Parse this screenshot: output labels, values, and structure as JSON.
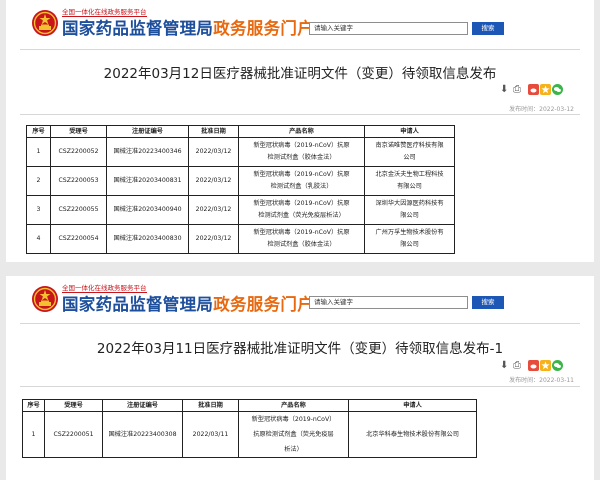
{
  "site": {
    "tagline": "全国一体化在线政务服务平台",
    "name_part1": "国家药品监督管理局",
    "name_part2": "政务服务门户",
    "search_placeholder": "请输入关键字",
    "search_button": "搜索"
  },
  "share_icons": [
    "download-icon",
    "print-icon",
    "weibo-icon",
    "qzone-icon",
    "wechat-icon"
  ],
  "colors": {
    "brand_blue": "#1d4f9c",
    "brand_orange": "#e86a10",
    "search_blue": "#1d57b5",
    "emblem_red": "#c8141b"
  },
  "columns": [
    "序号",
    "受理号",
    "注册证编号",
    "批准日期",
    "产品名称",
    "申请人"
  ],
  "posts": [
    {
      "title": "2022年03月12日医疗器械批准证明文件（变更）待领取信息发布",
      "date": "发布时间：2022-03-12",
      "rows": [
        {
          "no": "1",
          "accept": "CSZ2200052",
          "reg": "国械注准20223400346",
          "date": "2022/03/12",
          "product": [
            "新型冠状病毒（2019-nCoV）抗原",
            "检测试剂盒（胶体金法）"
          ],
          "applicant": [
            "南京诺唯赞医疗科技有限",
            "公司"
          ]
        },
        {
          "no": "2",
          "accept": "CSZ2200053",
          "reg": "国械注准20203400831",
          "date": "2022/03/12",
          "product": [
            "新型冠状病毒（2019-nCoV）抗原",
            "检测试剂盒（乳胶法）"
          ],
          "applicant": [
            "北京金沃夫生物工程科技",
            "有限公司"
          ]
        },
        {
          "no": "3",
          "accept": "CSZ2200055",
          "reg": "国械注准20203400940",
          "date": "2022/03/12",
          "product": [
            "新型冠状病毒（2019-nCoV）抗原",
            "检测试剂盒（荧光免疫层析法）"
          ],
          "applicant": [
            "深圳华大因源医药科技有",
            "限公司"
          ]
        },
        {
          "no": "4",
          "accept": "CSZ2200054",
          "reg": "国械注准20203400830",
          "date": "2022/03/12",
          "product": [
            "新型冠状病毒（2019-nCoV）抗原",
            "检测试剂盒（胶体金法）"
          ],
          "applicant": [
            "广州万孚生物技术股份有",
            "限公司"
          ]
        }
      ]
    },
    {
      "title": "2022年03月11日医疗器械批准证明文件（变更）待领取信息发布-1",
      "date": "发布时间：2022-03-11",
      "rows": [
        {
          "no": "1",
          "accept": "CSZ2200051",
          "reg": "国械注准20223400308",
          "date": "2022/03/11",
          "product": [
            "新型冠状病毒（2019-nCoV）",
            "抗原检测试剂盒（荧光免疫层",
            "析法）"
          ],
          "applicant": [
            "北京华科泰生物技术股份有限公司"
          ]
        }
      ]
    }
  ]
}
